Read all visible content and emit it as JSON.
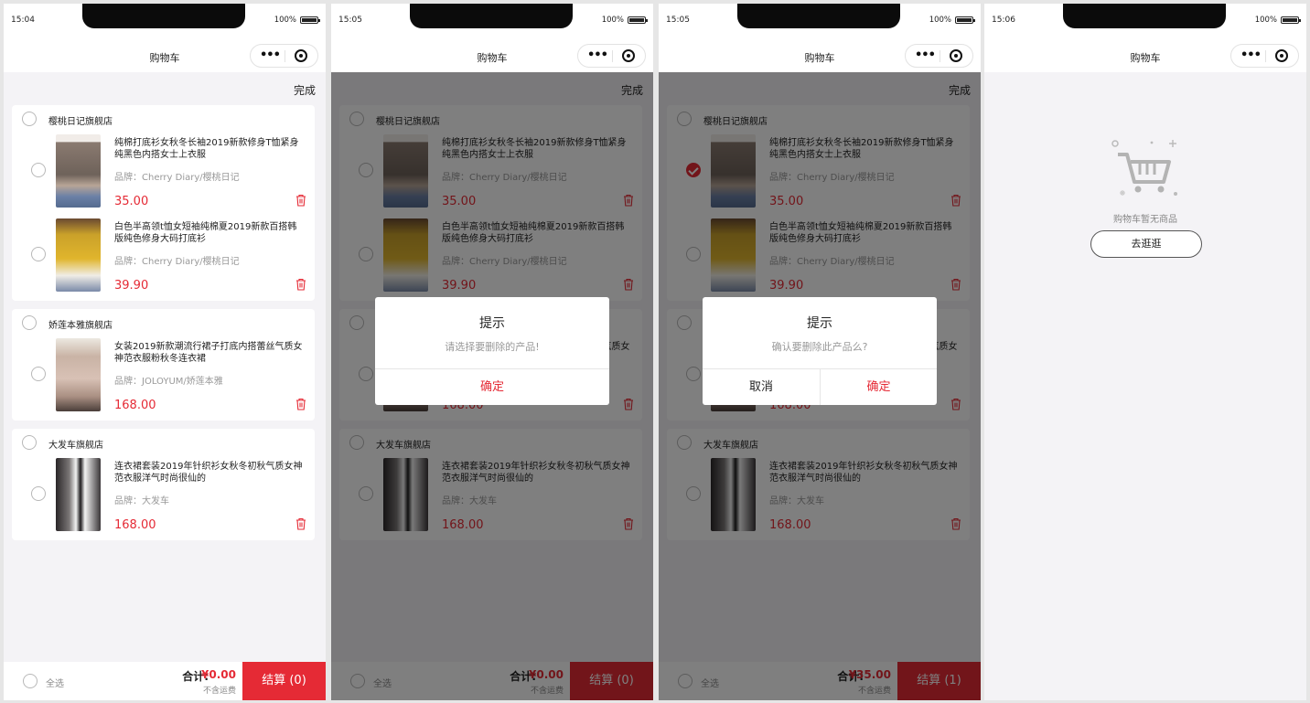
{
  "statusbar": {
    "battery": "100%"
  },
  "navbar": {
    "title": "购物车"
  },
  "cart": {
    "done_label": "完成",
    "stores": [
      {
        "name": "樱桃日记旗舰店",
        "items": [
          {
            "title": "纯棉打底衫女秋冬长袖2019新款修身T恤紧身纯黑色内搭女士上衣服",
            "brand": "品牌：Cherry Diary/樱桃日记",
            "price": "35.00"
          },
          {
            "title": "白色半高领t恤女短袖纯棉夏2019新款百搭韩版纯色修身大码打底衫",
            "brand": "品牌：Cherry Diary/樱桃日记",
            "price": "39.90"
          }
        ]
      },
      {
        "name": "娇莲本雅旗舰店",
        "items": [
          {
            "title": "女装2019新款潮流行裙子打底内搭蕾丝气质女神范衣服粉秋冬连衣裙",
            "brand": "品牌：JOLOYUM/娇莲本雅",
            "price": "168.00"
          }
        ]
      },
      {
        "name": "大发车旗舰店",
        "items": [
          {
            "title": "连衣裙套装2019年针织衫女秋冬初秋气质女神范衣服洋气时尚很仙的",
            "brand": "品牌：大发车",
            "price": "168.00"
          }
        ]
      }
    ],
    "select_all_label": "全选",
    "total_label": "合计:",
    "shipping_note": "不含运费"
  },
  "screens": [
    {
      "time": "15:04",
      "total_value": "¥0.00",
      "checkout_label": "结算 (0)"
    },
    {
      "time": "15:05",
      "total_value": "¥0.00",
      "checkout_label": "结算 (0)",
      "dialog": {
        "title": "提示",
        "message": "请选择要删除的产品!",
        "confirm": "确定"
      }
    },
    {
      "time": "15:05",
      "total_value": "¥35.00",
      "checkout_label": "结算 (1)",
      "dialog": {
        "title": "提示",
        "message": "确认要删除此产品么?",
        "cancel": "取消",
        "confirm": "确定"
      }
    },
    {
      "time": "15:06",
      "empty_text": "购物车暂无商品",
      "go_shopping_label": "去逛逛"
    }
  ],
  "colors": {
    "accent": "#e52a35",
    "background": "#f4f3f6",
    "mask": "rgba(0,0,0,0.5)"
  }
}
